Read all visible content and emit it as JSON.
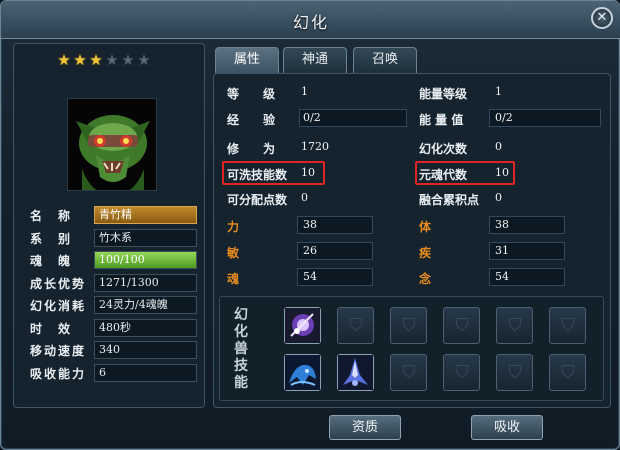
{
  "window": {
    "title": "幻化",
    "close_glyph": "✕"
  },
  "stars": {
    "filled": 3,
    "total": 6
  },
  "left_attributes": [
    {
      "label": "名　称",
      "value": "青竹精"
    },
    {
      "label": "系　别",
      "value": "竹木系"
    },
    {
      "label": "魂　魄",
      "value": "100/100",
      "fill": 1.0
    },
    {
      "label": "成长优势",
      "value": "1271/1300"
    },
    {
      "label": "幻化消耗",
      "value": "24灵力/4魂魄"
    },
    {
      "label": "时　效",
      "value": "480秒"
    },
    {
      "label": "移动速度",
      "value": "340"
    },
    {
      "label": "吸收能力",
      "value": "6"
    }
  ],
  "tabs": [
    {
      "label": "属性",
      "active": true
    },
    {
      "label": "神通",
      "active": false
    },
    {
      "label": "召唤",
      "active": false
    }
  ],
  "stats": {
    "level": {
      "label": "等　　级",
      "value": "1"
    },
    "exp": {
      "label": "经　　验",
      "value": "0/2"
    },
    "cultivation": {
      "label": "修　　为",
      "value": "1720"
    },
    "washable_skills": {
      "label": "可洗技能数",
      "value": "10"
    },
    "assignable_points": {
      "label": "可分配点数",
      "value": "0"
    },
    "energy_level": {
      "label": "能量等级",
      "value": "1"
    },
    "energy_value": {
      "label": "能 量 值",
      "value": "0/2"
    },
    "transform_count": {
      "label": "幻化次数",
      "value": "0"
    },
    "soul_gen": {
      "label": "元魂代数",
      "value": "10"
    },
    "fusion_points": {
      "label": "融合累积点",
      "value": "0"
    },
    "strength": {
      "label": "力",
      "value": "38"
    },
    "agility": {
      "label": "敏",
      "value": "26"
    },
    "soul": {
      "label": "魂",
      "value": "54"
    },
    "body": {
      "label": "体",
      "value": "38"
    },
    "speed": {
      "label": "疾",
      "value": "31"
    },
    "mind": {
      "label": "念",
      "value": "54"
    }
  },
  "skills": {
    "title": "幻化兽技能",
    "slots": [
      "purple-orb-skill",
      "empty",
      "empty",
      "empty",
      "empty",
      "empty",
      "blue-wolf-skill",
      "blue-spike-skill",
      "empty",
      "empty",
      "empty",
      "empty"
    ]
  },
  "buttons": {
    "aptitude": "资质",
    "absorb": "吸收"
  },
  "colors": {
    "highlight_outline": "#e02424",
    "orange_label": "#e88c1e",
    "star_on": "#f2c33e"
  }
}
